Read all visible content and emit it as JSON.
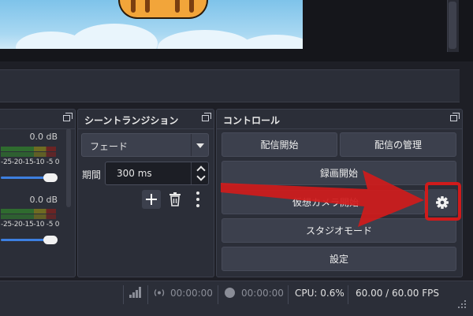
{
  "mixer": {
    "ch1_db": "0.0 dB",
    "ch2_db": "0.0 dB",
    "ticks": "-25-20-15-10 -5 0"
  },
  "transitions": {
    "title": "シーントランジション",
    "selected": "フェード",
    "duration_label": "期間",
    "duration_value": "300 ms"
  },
  "controls": {
    "title": "コントロール",
    "start_streaming": "配信開始",
    "manage_broadcast": "配信の管理",
    "start_recording": "録画開始",
    "start_virtual_camera": "仮想カメラ開始",
    "studio_mode": "スタジオモード",
    "settings": "設定"
  },
  "status": {
    "stream_time": "00:00:00",
    "record_time": "00:00:00",
    "cpu": "CPU: 0.6%",
    "fps": "60.00 / 60.00 FPS"
  },
  "colors": {
    "annotation_red": "#d01b1b",
    "accent_blue": "#3d7fe0"
  }
}
